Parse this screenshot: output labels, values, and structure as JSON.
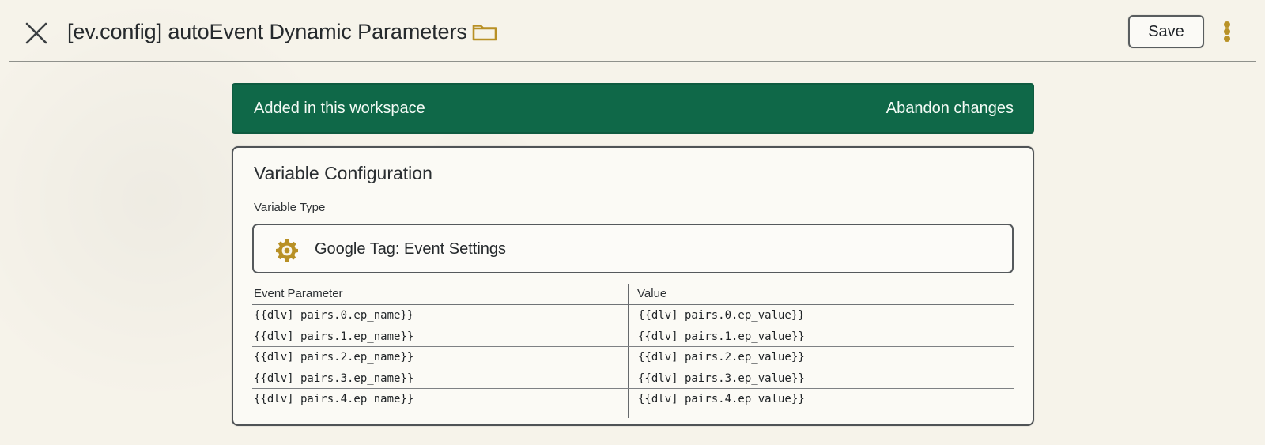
{
  "header": {
    "title": "[ev.config] autoEvent Dynamic Parameters",
    "save_label": "Save",
    "icons": {
      "close": "close-icon",
      "folder": "folder-icon",
      "more": "more-vertical-icon"
    }
  },
  "workspace_banner": {
    "text": "Added in this workspace",
    "action_label": "Abandon changes"
  },
  "configuration": {
    "title": "Variable Configuration",
    "variable_type_label": "Variable Type",
    "variable_type_value": "Google Tag: Event Settings",
    "variable_type_icon": "gear-icon",
    "table": {
      "headers": [
        "Event Parameter",
        "Value"
      ],
      "rows": [
        {
          "parameter": "{{dlv] pairs.0.ep_name}}",
          "value": "{{dlv] pairs.0.ep_value}}"
        },
        {
          "parameter": "{{dlv] pairs.1.ep_name}}",
          "value": "{{dlv] pairs.1.ep_value}}"
        },
        {
          "parameter": "{{dlv] pairs.2.ep_name}}",
          "value": "{{dlv] pairs.2.ep_value}}"
        },
        {
          "parameter": "{{dlv] pairs.3.ep_name}}",
          "value": "{{dlv] pairs.3.ep_value}}"
        },
        {
          "parameter": "{{dlv] pairs.4.ep_name}}",
          "value": "{{dlv] pairs.4.ep_value}}"
        }
      ]
    }
  },
  "colors": {
    "background": "#f6f3ea",
    "banner_green": "#0f6848",
    "accent_gold": "#b99227",
    "outline": "#4f5356"
  }
}
